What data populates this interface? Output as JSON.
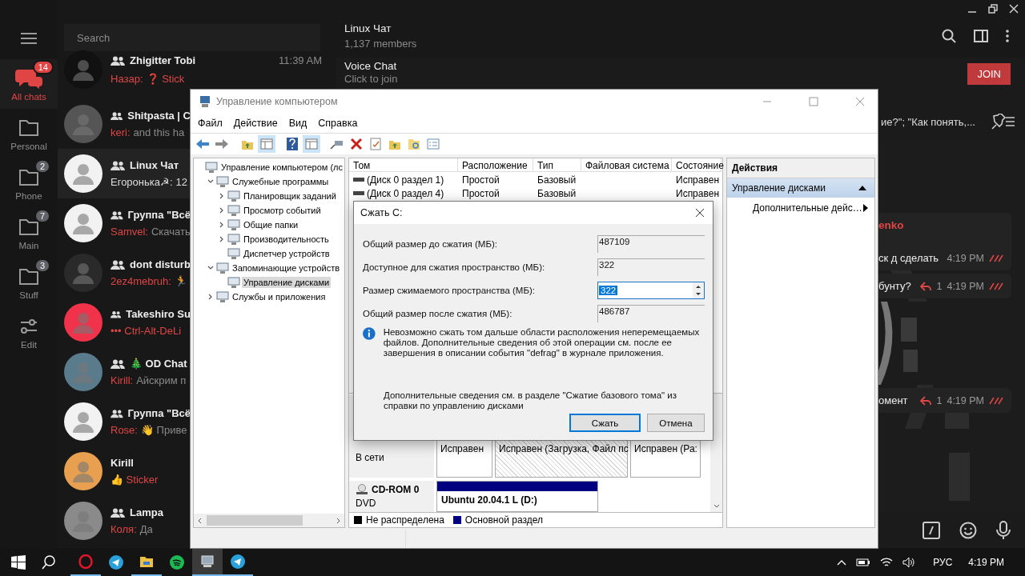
{
  "telegram": {
    "search": {
      "placeholder": "Search"
    },
    "folders": [
      {
        "kind": "chats",
        "label": "All chats",
        "badge": "14",
        "selected": true
      },
      {
        "kind": "folder",
        "label": "Personal",
        "selected": false
      },
      {
        "kind": "folder",
        "label": "Phone",
        "badge": "2",
        "selected": false
      },
      {
        "kind": "folder",
        "label": "Main",
        "badge": "7",
        "selected": false
      },
      {
        "kind": "folder",
        "label": "Stuff",
        "badge": "3",
        "selected": false
      },
      {
        "kind": "edit",
        "label": "Edit",
        "selected": false
      }
    ],
    "chats": [
      {
        "name": "Zhigitter Tobi",
        "group": true,
        "time": "11:39 AM",
        "sender": "Назар:",
        "text": "❓ Stick",
        "accent": true,
        "selected": false
      },
      {
        "name": "Shitpasta | C",
        "group": true,
        "sender": "keri:",
        "text": "and this ha",
        "accent": false,
        "selected": false
      },
      {
        "name": "Linux Чат",
        "group": true,
        "sender": "Егоронька☭:",
        "text": "12",
        "accent": false,
        "selected": true
      },
      {
        "name": "Группа \"Всё",
        "group": true,
        "sender": "Samvel:",
        "text": "Скачать",
        "accent": false,
        "selected": false
      },
      {
        "name": "dont disturb",
        "group": true,
        "sender": "2ez4mebruh:",
        "text": "🏃",
        "selected": false
      },
      {
        "name": "Takeshiro Su",
        "group": true,
        "text": "••• Ctrl-Alt-DeLi",
        "accent": true,
        "selected": false
      },
      {
        "name": "🎄 OD Chat",
        "group": true,
        "sender": "Kirill:",
        "text": "Айскрим п",
        "accent": false,
        "selected": false
      },
      {
        "name": "Группа \"Всё",
        "group": true,
        "sender": "Rose:",
        "text": "👋 Приве",
        "accent": false,
        "selected": false
      },
      {
        "name": "Kirill",
        "group": false,
        "text": "👍 Sticker",
        "accent": true,
        "selected": false
      },
      {
        "name": "Lampa",
        "group": true,
        "sender": "Коля:",
        "text": "Да",
        "accent": false,
        "selected": false
      }
    ],
    "header": {
      "title": "Linux Чат",
      "subtitle": "1,137 members"
    },
    "voice_chat": {
      "title": "Voice Chat",
      "subtitle": "Click to join",
      "button": "JOIN"
    },
    "pinned": {
      "text": "ие?\"; \"Как понять,..."
    },
    "messages": [
      {
        "kind": "text",
        "sender": "enko",
        "text": "ск д сделать",
        "time": "4:19 PM"
      },
      {
        "kind": "text",
        "text": "бунту?",
        "replies": "1",
        "time": "4:19 PM"
      },
      {
        "kind": "sticker"
      },
      {
        "kind": "text",
        "text": "омент",
        "replies": "1",
        "time": "4:19 PM"
      }
    ]
  },
  "computer_management": {
    "title": "Управление компьютером",
    "menu": [
      "Файл",
      "Действие",
      "Вид",
      "Справка"
    ],
    "toolbar": [
      {
        "kind": "back",
        "pressed": false
      },
      {
        "kind": "forward",
        "pressed": false
      },
      {
        "kind": "folder-up",
        "pressed": false
      },
      {
        "kind": "pane",
        "pressed": true
      },
      {
        "kind": "help",
        "pressed": false
      },
      {
        "kind": "pane",
        "pressed": true
      },
      {
        "kind": "plug",
        "pressed": false
      },
      {
        "kind": "delete",
        "pressed": false
      },
      {
        "kind": "checklist",
        "pressed": false
      },
      {
        "kind": "folder-up",
        "pressed": false
      },
      {
        "kind": "folder-search",
        "pressed": false
      },
      {
        "kind": "list",
        "pressed": false
      }
    ],
    "tree": [
      {
        "label": "Управление компьютером (лс",
        "selected": false,
        "children": [
          {
            "label": "Служебные программы",
            "expanded": true,
            "selected": false,
            "children": [
              {
                "label": "Планировщик заданий",
                "expanded": false,
                "selected": false
              },
              {
                "label": "Просмотр событий",
                "expanded": false,
                "selected": false
              },
              {
                "label": "Общие папки",
                "expanded": false,
                "selected": false
              },
              {
                "label": "Производительность",
                "expanded": false,
                "selected": false
              },
              {
                "label": "Диспетчер устройств",
                "selected": false
              }
            ]
          },
          {
            "label": "Запоминающие устройств",
            "expanded": true,
            "selected": false,
            "children": [
              {
                "label": "Управление дисками",
                "selected": true
              }
            ]
          },
          {
            "label": "Службы и приложения",
            "expanded": false,
            "selected": false
          }
        ]
      }
    ],
    "table": {
      "columns": [
        "Том",
        "Расположение",
        "Тип",
        "Файловая система",
        "Состояние"
      ],
      "rows": [
        {
          "volume": "(Диск 0 раздел 1)",
          "layout": "Простой",
          "type": "Базовый",
          "status": "Исправен"
        },
        {
          "volume": "(Диск 0 раздел 4)",
          "layout": "Простой",
          "type": "Базовый",
          "status": "Исправен"
        }
      ]
    },
    "disks": [
      {
        "state": "В сети",
        "partitions": [
          {
            "kind": "primary",
            "text": "Исправен",
            "selected": false
          },
          {
            "kind": "primary",
            "text": "Исправен (Загрузка, Файл пс",
            "selected": true
          },
          {
            "kind": "primary",
            "text": "Исправен (Ра:",
            "selected": false
          }
        ]
      },
      {
        "name": "CD-ROM 0",
        "type": "DVD",
        "partitions": [
          {
            "kind": "primary",
            "text": "Ubuntu 20.04.1 L  (D:)",
            "selected": false
          }
        ]
      }
    ],
    "legend": [
      {
        "label": "Не распределена",
        "color": "#000000"
      },
      {
        "label": "Основной раздел",
        "color": "#000080"
      }
    ],
    "actions": {
      "title": "Действия",
      "sections": [
        {
          "label": "Управление дисками",
          "items": [
            "Дополнительные дейс…"
          ]
        }
      ]
    }
  },
  "dialog": {
    "title": "Сжать C:",
    "fields": [
      {
        "kind": "readonly",
        "label": "Общий размер до сжатия (МБ):",
        "value": "487109"
      },
      {
        "kind": "readonly",
        "label": "Доступное для сжатия пространство (МБ):",
        "value": "322"
      },
      {
        "kind": "spin",
        "label": "Размер сжимаемого пространства (МБ):",
        "value": "322"
      },
      {
        "kind": "readonly",
        "label": "Общий размер после сжатия (МБ):",
        "value": "486787"
      }
    ],
    "info": "Невозможно сжать том дальше области расположения неперемещаемых файлов. Дополнительные сведения об этой операции см. после ее завершения в описании события \"defrag\" в журнале приложения.",
    "note": "Дополнительные сведения см. в разделе \"Сжатие базового тома\" из справки по управлению дисками",
    "buttons": [
      {
        "label": "Сжать",
        "default": true
      },
      {
        "label": "Отмена",
        "default": false
      }
    ]
  },
  "taskbar": {
    "apps": [
      {
        "kind": "opera",
        "running": true,
        "active": false
      },
      {
        "kind": "telegram",
        "running": false,
        "active": false
      },
      {
        "kind": "explorer",
        "running": true,
        "active": false
      },
      {
        "kind": "spotify",
        "running": false,
        "active": false
      },
      {
        "kind": "computer",
        "running": true,
        "active": true
      },
      {
        "kind": "telegram",
        "running": true,
        "active": false
      }
    ],
    "language": "РУС",
    "clock": "4:19 PM"
  }
}
